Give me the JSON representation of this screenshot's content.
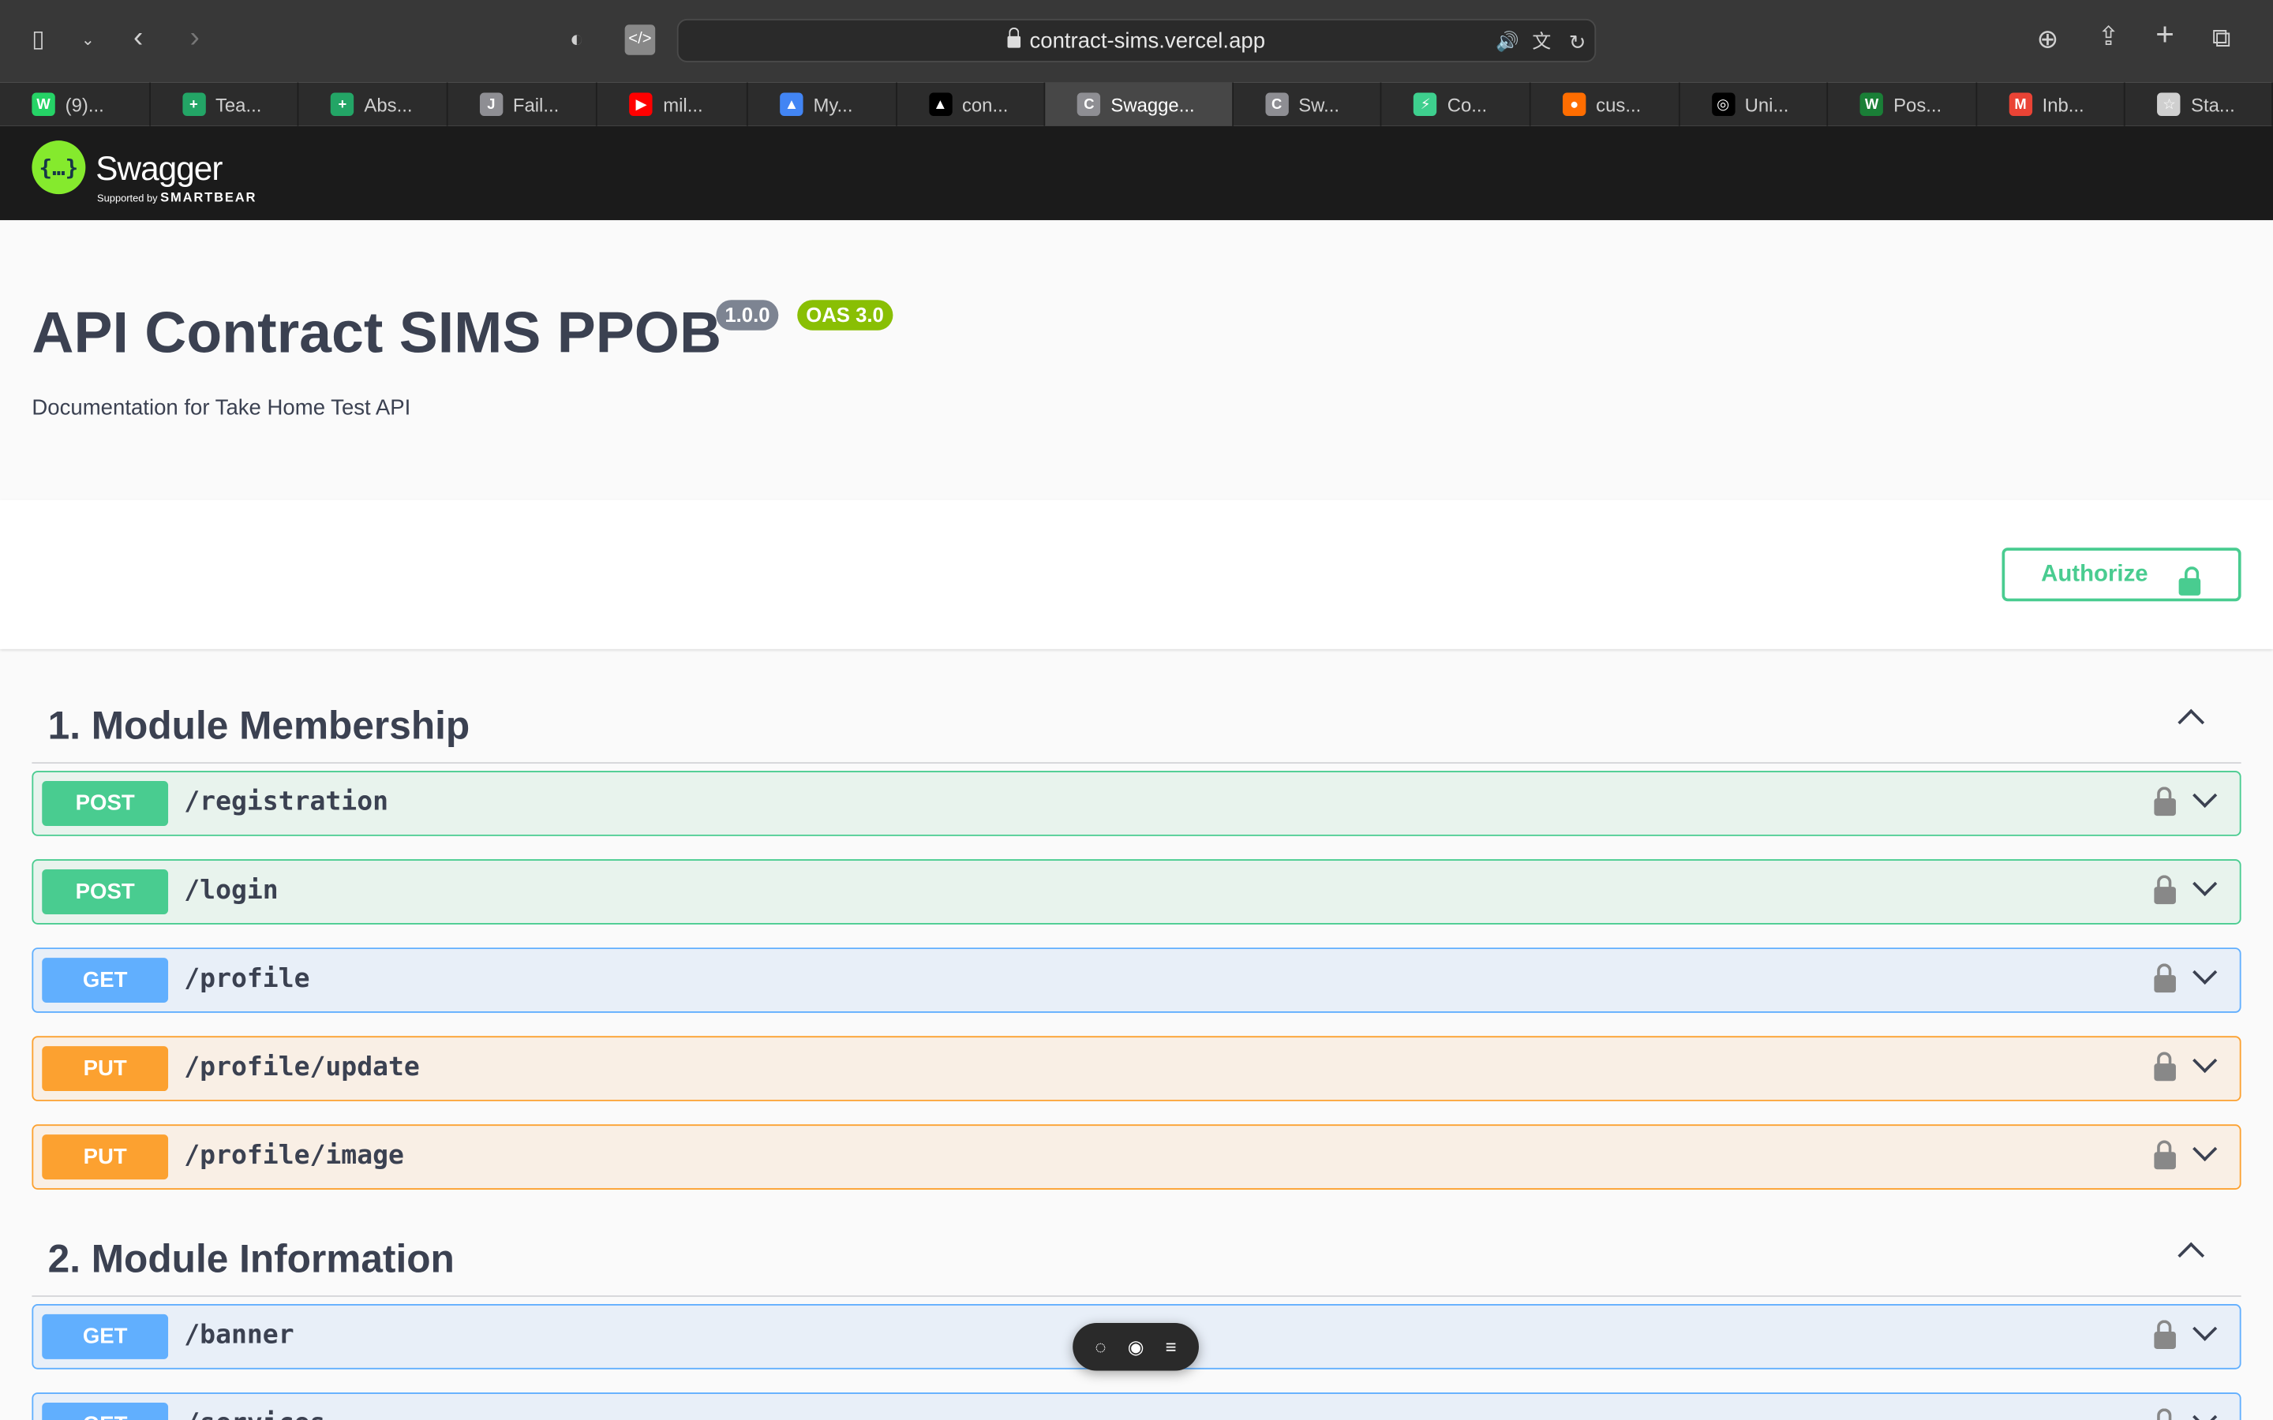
{
  "browser": {
    "url": "contract-sims.vercel.app",
    "tabs": [
      {
        "label": "(9)...",
        "color": "#25d366",
        "glyph": "W"
      },
      {
        "label": "Tea...",
        "color": "#23a566",
        "glyph": "+"
      },
      {
        "label": "Abs...",
        "color": "#23a566",
        "glyph": "+"
      },
      {
        "label": "Fail...",
        "color": "#8e8e93",
        "glyph": "J"
      },
      {
        "label": "mil...",
        "color": "#ff0000",
        "glyph": "▶"
      },
      {
        "label": "My...",
        "color": "#4285f4",
        "glyph": "▲"
      },
      {
        "label": "con...",
        "color": "#000000",
        "glyph": "▲"
      },
      {
        "label": "Swagge...",
        "color": "#8e8e93",
        "glyph": "C",
        "active": true
      },
      {
        "label": "Sw...",
        "color": "#8e8e93",
        "glyph": "C"
      },
      {
        "label": "Co...",
        "color": "#3ecf8e",
        "glyph": "⚡"
      },
      {
        "label": "cus...",
        "color": "#ff6d00",
        "glyph": "●"
      },
      {
        "label": "Uni...",
        "color": "#000000",
        "glyph": "◎"
      },
      {
        "label": "Pos...",
        "color": "#1a7f37",
        "glyph": "W"
      },
      {
        "label": "Inb...",
        "color": "#ea4335",
        "glyph": "M"
      },
      {
        "label": "Sta...",
        "color": "#cfcfcf",
        "glyph": "☆"
      }
    ]
  },
  "swagger": {
    "brand": "Swagger",
    "supported_by": "Supported by",
    "company": "SMARTBEAR"
  },
  "info": {
    "title": "API Contract SIMS PPOB",
    "version": "1.0.0",
    "oas": "OAS 3.0",
    "description": "Documentation for Take Home Test API"
  },
  "authorize_label": "Authorize",
  "sections": [
    {
      "title": "1. Module Membership",
      "ops": [
        {
          "method": "POST",
          "path": "/registration"
        },
        {
          "method": "POST",
          "path": "/login"
        },
        {
          "method": "GET",
          "path": "/profile"
        },
        {
          "method": "PUT",
          "path": "/profile/update"
        },
        {
          "method": "PUT",
          "path": "/profile/image"
        }
      ]
    },
    {
      "title": "2. Module Information",
      "ops": [
        {
          "method": "GET",
          "path": "/banner"
        },
        {
          "method": "GET",
          "path": "/services"
        }
      ]
    }
  ],
  "colors": {
    "post": "#49cc90",
    "get": "#61affe",
    "put": "#fca130"
  }
}
